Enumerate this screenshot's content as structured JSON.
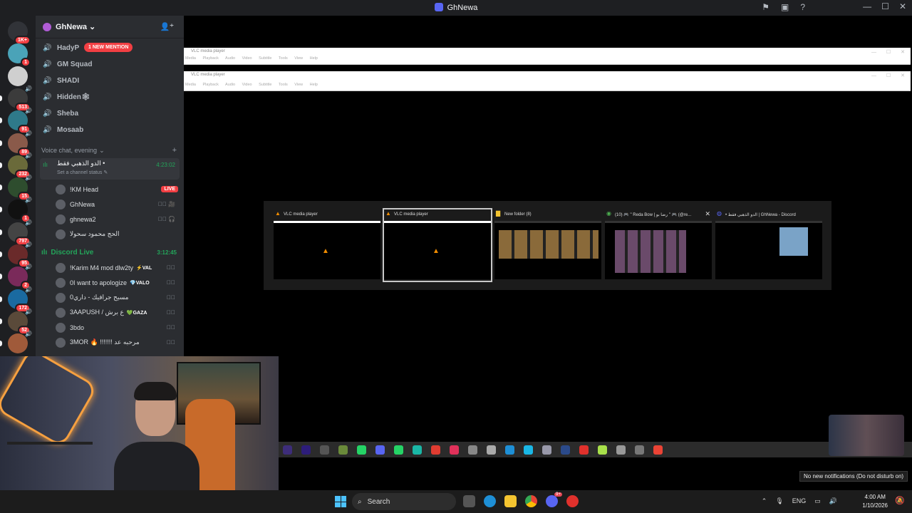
{
  "window": {
    "title": "GhNewa",
    "controls": [
      "—",
      "☐",
      "✕"
    ]
  },
  "guilds": [
    {
      "badge": "1K+",
      "icon": "discord-home-icon",
      "color": "#313338"
    },
    {
      "badge": "1",
      "icon": "server-avatar-icon",
      "color": "#4aa3b8"
    },
    {
      "badge": "",
      "icon": "pubg-server-icon",
      "color": "#cfcfcf"
    },
    {
      "badge": "513",
      "icon": "server-icon",
      "color": "#3b3b3b"
    },
    {
      "badge": "91",
      "icon": "server-icon",
      "color": "#2f7a8a"
    },
    {
      "badge": "89",
      "icon": "server-icon",
      "color": "#8a5a4a"
    },
    {
      "badge": "232",
      "icon": "server-icon",
      "color": "#6a6a3a"
    },
    {
      "badge": "15",
      "icon": "server-icon",
      "color": "#2e4d2e"
    },
    {
      "badge": "1",
      "icon": "gh-server-icon",
      "color": "#111111"
    },
    {
      "badge": "797",
      "icon": "server-icon",
      "color": "#444444"
    },
    {
      "badge": "95",
      "icon": "server-icon",
      "color": "#6a2a2a"
    },
    {
      "badge": "2",
      "icon": "server-icon",
      "color": "#7a2a5a"
    },
    {
      "badge": "172",
      "icon": "server-icon",
      "color": "#1a6aa0"
    },
    {
      "badge": "52",
      "icon": "server-icon",
      "color": "#5a4a3a"
    },
    {
      "badge": "",
      "icon": "server-icon",
      "color": "#a05a3a"
    }
  ],
  "server": {
    "name": "GhNewa",
    "mention_badge": "1 NEW MENTION",
    "channels": [
      "HadyP",
      "GM Squad",
      "SHADI",
      "Hidden🕸",
      "Sheba",
      "Mosaab"
    ],
    "category": "Voice chat, evening",
    "active_voice": {
      "name": "الدو الذهبي فقط •",
      "status": "Set a channel status ✎",
      "timer": "4:23:02"
    },
    "voice_users": [
      {
        "name": "!KM Head",
        "live": "LIVE",
        "muted": ""
      },
      {
        "name": "GhNewa",
        "live": "",
        "muted": "🎙⃠ 🎥"
      },
      {
        "name": "ghnewa2",
        "live": "",
        "muted": "🎙⃠ 🎧"
      },
      {
        "name": "الحج محمود سحولا",
        "live": "",
        "muted": ""
      }
    ],
    "live_category": {
      "name": "Discord Live",
      "timer": "3:12:45"
    },
    "live_users": [
      {
        "name": "!Karim M4 mod dlw2ty",
        "tag": "⚡VAL",
        "tag_color": "#ffffff"
      },
      {
        "name": "0I want to apologize",
        "tag": "💎VALO",
        "tag_color": "#ffffff"
      },
      {
        "name": "مسيح جرافيك - داري0",
        "tag": "",
        "tag_color": ""
      },
      {
        "name": "3AAPUSH / ع برش",
        "tag": "💚GAZA",
        "tag_color": "#ffffff"
      },
      {
        "name": "3bdo",
        "tag": "",
        "tag_color": ""
      },
      {
        "name": "3MOR 🔥 !!!!!!! مرحبه عد",
        "tag": "",
        "tag_color": ""
      }
    ]
  },
  "vlc_windows": [
    {
      "title": "VLC media player",
      "menu": "Media Playback Audio Video Subtitle Tools View Help"
    },
    {
      "title": "VLC media player",
      "menu": "Media Playback Audio Video Subtitle Tools View Help"
    }
  ],
  "alt_tab": [
    {
      "title": "VLC media player",
      "icon": "vlc-icon",
      "selected": false
    },
    {
      "title": "VLC media player",
      "icon": "vlc-icon",
      "selected": true
    },
    {
      "title": "New folder (8)",
      "icon": "folder-icon",
      "selected": false
    },
    {
      "title": "(10) 🎮 \" Reda Bow | رضا بو \" 🎮 (@re...",
      "icon": "chrome-icon",
      "selected": false
    },
    {
      "title": "• الدو الذهبي فقط | GhNewa - Discord",
      "icon": "discord-icon",
      "selected": false
    }
  ],
  "notification": "No new notifications (Do not disturb on)",
  "taskbar": {
    "search_placeholder": "Search",
    "discord_badge": "9+",
    "tray": {
      "lang": "ENG"
    },
    "clock": {
      "time": "4:00 AM",
      "date": "1/10/2026"
    }
  },
  "colors": {
    "discord_bg": "#2b2d31",
    "accent_red": "#f23f43",
    "live_green": "#23a55a",
    "vlc_orange": "#f08c00"
  }
}
